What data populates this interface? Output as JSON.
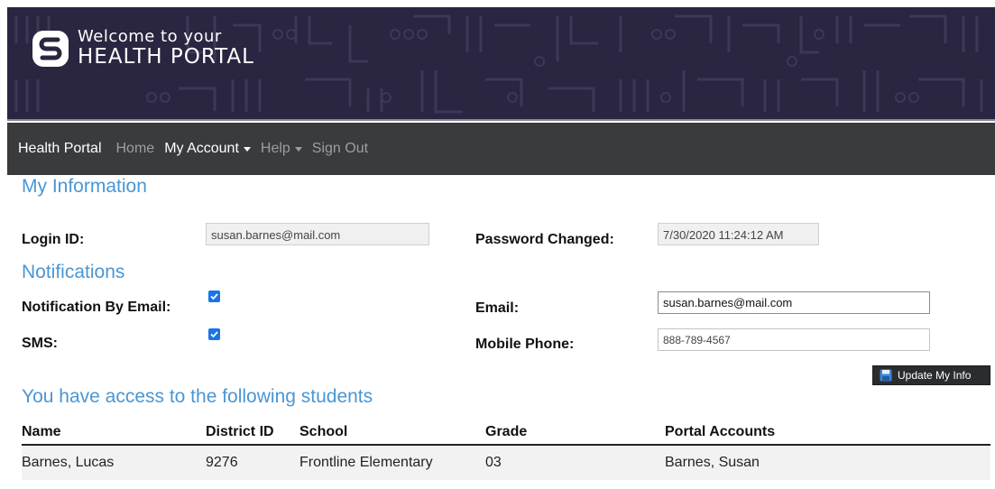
{
  "banner": {
    "line1": "Welcome to your",
    "line2": "HEALTH PORTAL"
  },
  "navbar": {
    "brand": "Health Portal",
    "home": "Home",
    "my_account": "My Account",
    "help": "Help",
    "sign_out": "Sign Out"
  },
  "my_information": {
    "title": "My Information",
    "login_id_label": "Login ID:",
    "login_id_value": "susan.barnes@mail.com",
    "password_changed_label": "Password Changed:",
    "password_changed_value": "7/30/2020 11:24:12 AM"
  },
  "notifications": {
    "title": "Notifications",
    "by_email_label": "Notification By Email:",
    "by_email_checked": true,
    "sms_label": "SMS:",
    "sms_checked": true,
    "email_label": "Email:",
    "email_value": "susan.barnes@mail.com",
    "mobile_label": "Mobile Phone:",
    "mobile_value": "888-789-4567"
  },
  "update_button": {
    "label": "Update My Info"
  },
  "students": {
    "title": "You have access to the following students",
    "columns": [
      "Name",
      "District ID",
      "School",
      "Grade",
      "Portal Accounts"
    ],
    "rows": [
      [
        "Barnes, Lucas",
        "9276",
        "Frontline Elementary",
        "03",
        "Barnes, Susan"
      ]
    ]
  },
  "colors": {
    "banner_bg": "#2a2540",
    "navbar_bg": "#3a3b3d",
    "section_title": "#4a96d4",
    "checkbox": "#1a73e8"
  }
}
